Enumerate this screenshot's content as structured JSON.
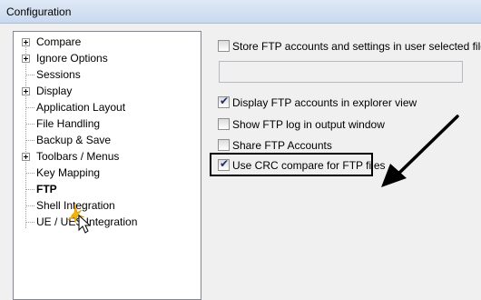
{
  "window": {
    "title": "Configuration"
  },
  "tree": {
    "items": [
      {
        "label": "Compare",
        "expandable": true
      },
      {
        "label": "Ignore Options",
        "expandable": true
      },
      {
        "label": "Sessions",
        "expandable": false
      },
      {
        "label": "Display",
        "expandable": true
      },
      {
        "label": "Application Layout",
        "expandable": false
      },
      {
        "label": "File Handling",
        "expandable": false
      },
      {
        "label": "Backup & Save",
        "expandable": false
      },
      {
        "label": "Toolbars / Menus",
        "expandable": true
      },
      {
        "label": "Key Mapping",
        "expandable": false
      },
      {
        "label": "FTP",
        "expandable": false,
        "selected": true
      },
      {
        "label": "Shell Integration",
        "expandable": false
      },
      {
        "label": "UE / UES Integration",
        "expandable": false
      }
    ]
  },
  "options": {
    "store_accounts": {
      "label": "Store FTP accounts and settings in user selected file",
      "checked": false
    },
    "file_path": {
      "value": ""
    },
    "display_accounts": {
      "label": "Display FTP accounts in explorer view",
      "checked": true
    },
    "show_log": {
      "label": "Show FTP log in output window",
      "checked": false
    },
    "share_accounts": {
      "label": "Share FTP Accounts",
      "checked": false
    },
    "crc_compare": {
      "label": "Use CRC compare for FTP files",
      "checked": true
    }
  },
  "annotation": {
    "arrow_color": "#000000",
    "box_color": "#000000"
  }
}
